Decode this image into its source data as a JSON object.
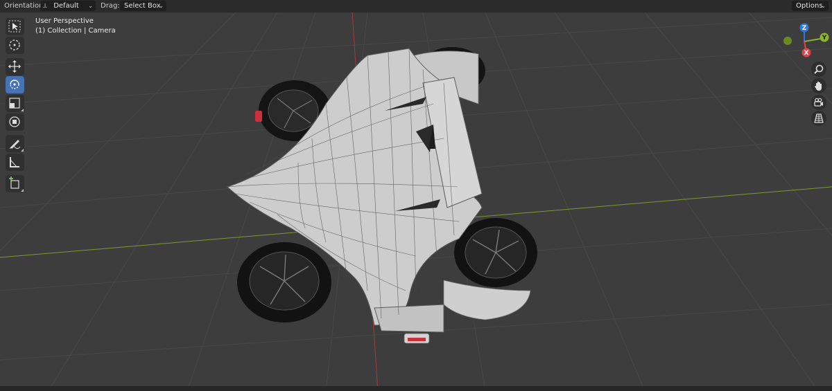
{
  "header": {
    "orientation_label": "Orientation:",
    "orientation_value": "Default",
    "drag_label": "Drag:",
    "drag_value": "Select Box",
    "options_label": "Options"
  },
  "viewport": {
    "perspective": "User Perspective",
    "collection": "(1) Collection | Camera",
    "object": "vehicle-model"
  },
  "gizmo": {
    "axes": [
      "Z",
      "Y",
      "X"
    ],
    "colors": {
      "x": "#e4404a",
      "y": "#8ab42a",
      "z": "#2f78e0",
      "y_neg": "#6a8a24"
    }
  },
  "toolbar": {
    "tools": [
      {
        "name": "select-box-tool",
        "icon": "select-cursor-icon"
      },
      {
        "name": "cursor-tool",
        "icon": "crosshair-icon"
      },
      {
        "name": "move-tool",
        "icon": "move-icon"
      },
      {
        "name": "rotate-tool",
        "icon": "rotate-icon"
      },
      {
        "name": "scale-tool",
        "icon": "scale-icon"
      },
      {
        "name": "transform-tool",
        "icon": "transform-icon"
      },
      {
        "name": "annotate-tool",
        "icon": "pencil-icon"
      },
      {
        "name": "measure-tool",
        "icon": "ruler-icon"
      },
      {
        "name": "add-cube-tool",
        "icon": "add-cube-icon"
      }
    ],
    "active": "rotate-tool"
  },
  "nav_buttons": [
    "zoom-icon",
    "hand-icon",
    "camera-icon",
    "grid-icon"
  ],
  "colors": {
    "viewport_bg": "#3d3d3d",
    "grid_line": "#464646",
    "x_axis_line": "#7d9a2e",
    "y_axis_line": "#a53a44",
    "active_tool": "#4772b3"
  }
}
